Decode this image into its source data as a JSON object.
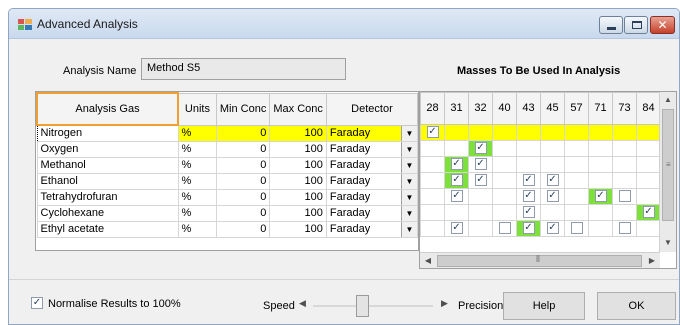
{
  "window": {
    "title": "Advanced Analysis",
    "minimize_glyph": "",
    "maximize_glyph": "",
    "close_glyph": "✕"
  },
  "analysis_name": {
    "label": "Analysis Name",
    "value": "Method S5"
  },
  "masses_title": "Masses To Be Used In Analysis",
  "gas_table": {
    "headers": {
      "gas": "Analysis Gas",
      "units": "Units",
      "min_conc": "Min Conc",
      "max_conc": "Max Conc",
      "detector": "Detector"
    },
    "rows": [
      {
        "gas": "Nitrogen",
        "units": "%",
        "min": "0",
        "max": "100",
        "detector": "Faraday"
      },
      {
        "gas": "Oxygen",
        "units": "%",
        "min": "0",
        "max": "100",
        "detector": "Faraday"
      },
      {
        "gas": "Methanol",
        "units": "%",
        "min": "0",
        "max": "100",
        "detector": "Faraday"
      },
      {
        "gas": "Ethanol",
        "units": "%",
        "min": "0",
        "max": "100",
        "detector": "Faraday"
      },
      {
        "gas": "Tetrahydrofuran",
        "units": "%",
        "min": "0",
        "max": "100",
        "detector": "Faraday"
      },
      {
        "gas": "Cyclohexane",
        "units": "%",
        "min": "0",
        "max": "100",
        "detector": "Faraday"
      },
      {
        "gas": "Ethyl acetate",
        "units": "%",
        "min": "0",
        "max": "100",
        "detector": "Faraday"
      }
    ],
    "selected_row": 0
  },
  "mass_table": {
    "masses": [
      "28",
      "31",
      "32",
      "40",
      "43",
      "45",
      "57",
      "71",
      "73",
      "84"
    ],
    "highlight_color": "#7ee03a",
    "selected_row_color": "#ffff00",
    "rows": [
      {
        "gas": "Nitrogen",
        "checked": [
          28
        ],
        "unchecked_visible": [],
        "highlight": []
      },
      {
        "gas": "Oxygen",
        "checked": [
          32
        ],
        "unchecked_visible": [],
        "highlight": [
          32
        ]
      },
      {
        "gas": "Methanol",
        "checked": [
          31,
          32
        ],
        "unchecked_visible": [],
        "highlight": [
          31
        ]
      },
      {
        "gas": "Ethanol",
        "checked": [
          31,
          32,
          43,
          45
        ],
        "unchecked_visible": [],
        "highlight": [
          31
        ]
      },
      {
        "gas": "Tetrahydrofuran",
        "checked": [
          31,
          43,
          45,
          71
        ],
        "unchecked_visible": [
          73
        ],
        "highlight": [
          71
        ]
      },
      {
        "gas": "Cyclohexane",
        "checked": [
          43,
          84
        ],
        "unchecked_visible": [],
        "highlight": [
          84
        ]
      },
      {
        "gas": "Ethyl acetate",
        "checked": [
          31,
          43,
          45
        ],
        "unchecked_visible": [
          40,
          57,
          73
        ],
        "highlight": [
          43
        ]
      }
    ]
  },
  "icons": {
    "dropdown": "dropdown-arrow-icon",
    "checkbox_check": "✓"
  },
  "normalise": {
    "label": "Normalise Results to 100%",
    "checked": true
  },
  "speed": {
    "label": "Speed",
    "value_fraction": 0.4
  },
  "precision_label": "Precision",
  "buttons": {
    "help": "Help",
    "ok": "OK"
  }
}
